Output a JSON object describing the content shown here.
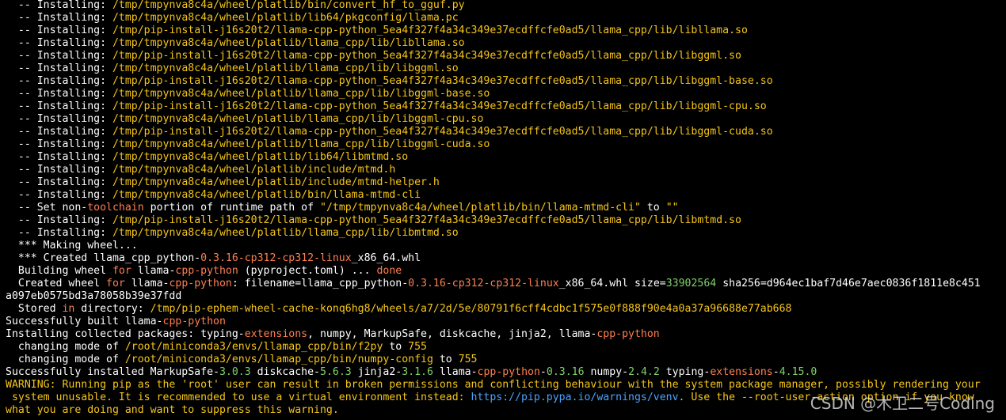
{
  "colors": {
    "background": "#000000",
    "text": "#ffffff",
    "path": "#f5c518",
    "keyword": "#ff7f50",
    "link": "#4aa3ff",
    "number": "#7fd16b"
  },
  "lines": [
    [
      [
        "w",
        "  -- Installing: "
      ],
      [
        "y",
        "/tmp/tmpynva8c4a/wheel/platlib/bin/convert_hf_to_gguf.py"
      ]
    ],
    [
      [
        "w",
        "  -- Installing: "
      ],
      [
        "y",
        "/tmp/tmpynva8c4a/wheel/platlib/lib64/pkgconfig/llama.pc"
      ]
    ],
    [
      [
        "w",
        "  -- Installing: "
      ],
      [
        "y",
        "/tmp/pip-install-j16s20t2/llama-cpp-python_5ea4f327f4a34c349e37ecdffcfe0ad5/llama_cpp/lib/libllama.so"
      ]
    ],
    [
      [
        "w",
        "  -- Installing: "
      ],
      [
        "y",
        "/tmp/tmpynva8c4a/wheel/platlib/llama_cpp/lib/libllama.so"
      ]
    ],
    [
      [
        "w",
        "  -- Installing: "
      ],
      [
        "y",
        "/tmp/pip-install-j16s20t2/llama-cpp-python_5ea4f327f4a34c349e37ecdffcfe0ad5/llama_cpp/lib/libggml.so"
      ]
    ],
    [
      [
        "w",
        "  -- Installing: "
      ],
      [
        "y",
        "/tmp/tmpynva8c4a/wheel/platlib/llama_cpp/lib/libggml.so"
      ]
    ],
    [
      [
        "w",
        "  -- Installing: "
      ],
      [
        "y",
        "/tmp/pip-install-j16s20t2/llama-cpp-python_5ea4f327f4a34c349e37ecdffcfe0ad5/llama_cpp/lib/libggml-base.so"
      ]
    ],
    [
      [
        "w",
        "  -- Installing: "
      ],
      [
        "y",
        "/tmp/tmpynva8c4a/wheel/platlib/llama_cpp/lib/libggml-base.so"
      ]
    ],
    [
      [
        "w",
        "  -- Installing: "
      ],
      [
        "y",
        "/tmp/pip-install-j16s20t2/llama-cpp-python_5ea4f327f4a34c349e37ecdffcfe0ad5/llama_cpp/lib/libggml-cpu.so"
      ]
    ],
    [
      [
        "w",
        "  -- Installing: "
      ],
      [
        "y",
        "/tmp/tmpynva8c4a/wheel/platlib/llama_cpp/lib/libggml-cpu.so"
      ]
    ],
    [
      [
        "w",
        "  -- Installing: "
      ],
      [
        "y",
        "/tmp/pip-install-j16s20t2/llama-cpp-python_5ea4f327f4a34c349e37ecdffcfe0ad5/llama_cpp/lib/libggml-cuda.so"
      ]
    ],
    [
      [
        "w",
        "  -- Installing: "
      ],
      [
        "y",
        "/tmp/tmpynva8c4a/wheel/platlib/llama_cpp/lib/libggml-cuda.so"
      ]
    ],
    [
      [
        "w",
        "  -- Installing: "
      ],
      [
        "y",
        "/tmp/tmpynva8c4a/wheel/platlib/lib64/libmtmd.so"
      ]
    ],
    [
      [
        "w",
        "  -- Installing: "
      ],
      [
        "y",
        "/tmp/tmpynva8c4a/wheel/platlib/include/mtmd.h"
      ]
    ],
    [
      [
        "w",
        "  -- Installing: "
      ],
      [
        "y",
        "/tmp/tmpynva8c4a/wheel/platlib/include/mtmd-helper.h"
      ]
    ],
    [
      [
        "w",
        "  -- Installing: "
      ],
      [
        "y",
        "/tmp/tmpynva8c4a/wheel/platlib/bin/llama-mtmd-cli"
      ]
    ],
    [
      [
        "w",
        "  -- Set non-"
      ],
      [
        "o",
        "toolchain"
      ],
      [
        "w",
        " portion of runtime path of "
      ],
      [
        "y",
        "\"/tmp/tmpynva8c4a/wheel/platlib/bin/llama-mtmd-cli\""
      ],
      [
        "w",
        " to "
      ],
      [
        "y",
        "\"\""
      ]
    ],
    [
      [
        "w",
        "  -- Installing: "
      ],
      [
        "y",
        "/tmp/pip-install-j16s20t2/llama-cpp-python_5ea4f327f4a34c349e37ecdffcfe0ad5/llama_cpp/lib/libmtmd.so"
      ]
    ],
    [
      [
        "w",
        "  -- Installing: "
      ],
      [
        "y",
        "/tmp/tmpynva8c4a/wheel/platlib/llama_cpp/lib/libmtmd.so"
      ]
    ],
    [
      [
        "w",
        "  *** Making wheel..."
      ]
    ],
    [
      [
        "w",
        "  *** Created llama_cpp_python-"
      ],
      [
        "o",
        "0.3.16-cp312-cp312-linux"
      ],
      [
        "w",
        "_x86_64.whl"
      ]
    ],
    [
      [
        "w",
        "  Building wheel "
      ],
      [
        "o",
        "for"
      ],
      [
        "w",
        " llama-"
      ],
      [
        "o",
        "cpp-python"
      ],
      [
        "w",
        " (pyproject.toml) ... "
      ],
      [
        "o",
        "done"
      ]
    ],
    [
      [
        "w",
        "  Created wheel "
      ],
      [
        "o",
        "for"
      ],
      [
        "w",
        " llama-"
      ],
      [
        "o",
        "cpp-python"
      ],
      [
        "w",
        ": filename=llama_cpp_python-"
      ],
      [
        "o",
        "0.3.16-cp312-cp312-linux"
      ],
      [
        "w",
        "_x86_64.whl size="
      ],
      [
        "g",
        "33902564"
      ],
      [
        "w",
        " sha256=d964ec1baf7d46e7aec0836f1811e8c451"
      ]
    ],
    [
      [
        "w",
        "a097eb0575bd3a78058b39e37fdd"
      ]
    ],
    [
      [
        "w",
        "  Stored "
      ],
      [
        "o",
        "in"
      ],
      [
        "w",
        " directory: "
      ],
      [
        "y",
        "/tmp/pip-ephem-wheel-cache-konq6hg8/wheels/a7/2d/5e/80791f6cff4cdbc1f575e0f888f90e4a0a37a96688e77ab668"
      ]
    ],
    [
      [
        "w",
        "Successfully built llama-"
      ],
      [
        "o",
        "cpp-python"
      ]
    ],
    [
      [
        "w",
        "Installing collected packages: typing-"
      ],
      [
        "o",
        "extensions"
      ],
      [
        "w",
        ", numpy, MarkupSafe, diskcache, jinja2, llama-"
      ],
      [
        "o",
        "cpp-python"
      ]
    ],
    [
      [
        "w",
        "  changing mode of "
      ],
      [
        "y",
        "/root/miniconda3/envs/llamap_cpp/bin/f2py"
      ],
      [
        "w",
        " to "
      ],
      [
        "y",
        "755"
      ]
    ],
    [
      [
        "w",
        "  changing mode of "
      ],
      [
        "y",
        "/root/miniconda3/envs/llamap_cpp/bin/numpy-config"
      ],
      [
        "w",
        " to "
      ],
      [
        "y",
        "755"
      ]
    ],
    [
      [
        "w",
        "Successfully installed MarkupSafe-"
      ],
      [
        "g",
        "3.0.3"
      ],
      [
        "w",
        " diskcache-"
      ],
      [
        "g",
        "5.6.3"
      ],
      [
        "w",
        " jinja2-"
      ],
      [
        "g",
        "3.1.6"
      ],
      [
        "w",
        " llama-"
      ],
      [
        "o",
        "cpp-python"
      ],
      [
        "w",
        "-"
      ],
      [
        "g",
        "0.3.16"
      ],
      [
        "w",
        " numpy-"
      ],
      [
        "g",
        "2.4.2"
      ],
      [
        "w",
        " typing-"
      ],
      [
        "o",
        "extensions"
      ],
      [
        "w",
        "-"
      ],
      [
        "g",
        "4.15.0"
      ]
    ],
    [
      [
        "y",
        "WARNING: Running pip as the 'root' user can result in broken permissions and conflicting behaviour with the system package manager, possibly rendering your"
      ]
    ],
    [
      [
        "y",
        " system unusable. It is recommended to use a virtual environment instead: "
      ],
      [
        "b",
        "https://pip.pypa.io/warnings/venv"
      ],
      [
        "y",
        ". Use the --root-user-action option if you know"
      ]
    ],
    [
      [
        "y",
        "what you are doing and want to suppress this warning."
      ]
    ]
  ],
  "watermark": "CSDN @木卫二号Coding"
}
